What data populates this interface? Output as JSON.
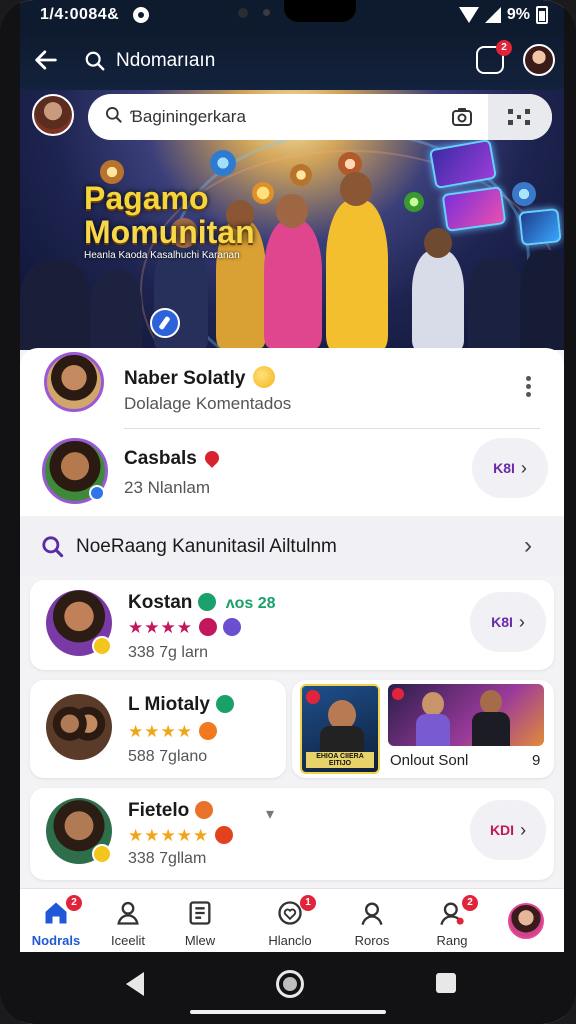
{
  "status_bar": {
    "time": "1/4:0084&",
    "battery": "9%"
  },
  "app_bar": {
    "search_label": "Ndomarıaın",
    "messages_badge": "2",
    "avatar_badge": ""
  },
  "hero": {
    "search_placeholder": "Ɓaginingerkara",
    "title_line1": "Pagamo",
    "title_line2": "Momunitan",
    "subtitle": "Heanla Kaoda Kasalhuchi Karanan"
  },
  "community_card": {
    "rows": [
      {
        "title": "Naber Solatly",
        "subtitle": "Dolalage Komentados"
      },
      {
        "title": "Casbals",
        "subtitle": "23 Nlanlam",
        "button": "K8I"
      }
    ]
  },
  "search_row": {
    "label": "NoeRaang Kanunitasil Ailtulnm"
  },
  "list": [
    {
      "title": "Kostan",
      "tag": "ʌos 28",
      "subtitle": "338 7g larn",
      "button": "K8I"
    },
    {
      "title": "L Miotaly",
      "subtitle": "588 7glano",
      "thumb_caption_right": "Onlout Sonl",
      "thumb_count": "9",
      "thumb_left_caption": "EHIOA CIIERA EITIJO"
    },
    {
      "title": "Fietelo",
      "subtitle": "338 7gllam",
      "button": "KDI"
    }
  ],
  "bottom_nav": [
    {
      "label": "Nodrals",
      "badge": "2",
      "active": true
    },
    {
      "label": "Iceelit",
      "badge": ""
    },
    {
      "label": "Mlew",
      "badge": ""
    },
    {
      "label": "Hlanclo",
      "badge": "1"
    },
    {
      "label": "Roros",
      "badge": ""
    },
    {
      "label": "Rang",
      "badge": "2"
    }
  ],
  "colors": {
    "accent": "#1f59d6",
    "purple": "#6a2ba8",
    "badge": "#e2243a",
    "header": "#0e1a2e"
  },
  "icons": [
    "back-arrow-icon",
    "search-icon",
    "message-icon",
    "camera-icon",
    "scan-icon",
    "kebab-menu-icon",
    "chevron-right-icon",
    "home-icon",
    "person-icon",
    "news-icon",
    "heart-icon",
    "profile-icon",
    "add-person-icon"
  ]
}
